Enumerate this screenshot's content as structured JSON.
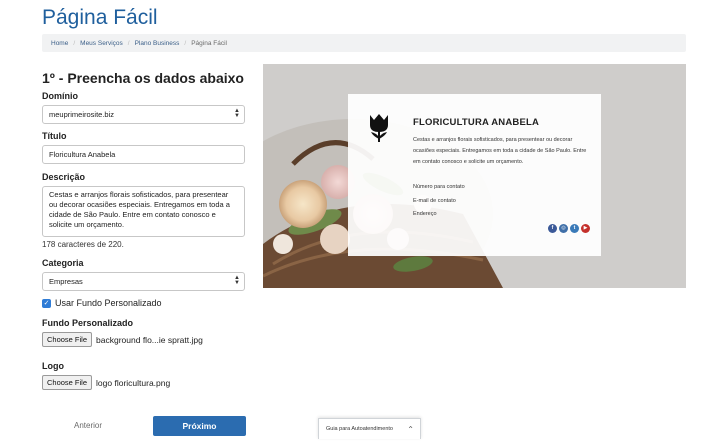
{
  "page": {
    "title": "Página Fácil"
  },
  "breadcrumb": [
    "Home",
    "Meus Serviços",
    "Plano Business",
    "Página Fácil"
  ],
  "form": {
    "step_title": "1º - Preencha os dados abaixo",
    "domain": {
      "label": "Domínio",
      "value": "meuprimeirosite.biz"
    },
    "title": {
      "label": "Título",
      "value": "Floricultura Anabela"
    },
    "description": {
      "label": "Descrição",
      "value": "Cestas e arranjos florais sofisticados, para presentear ou decorar ocasiões especiais. Entregamos em toda a cidade de São Paulo. Entre em contato conosco e solicite um orçamento.",
      "counter": "178 caracteres de 220."
    },
    "category": {
      "label": "Categoria",
      "value": "Empresas"
    },
    "custom_bg_checkbox": {
      "label": "Usar Fundo Personalizado",
      "checked": true
    },
    "custom_bg": {
      "label": "Fundo Personalizado",
      "button": "Choose File",
      "file": "background flo...ie spratt.jpg"
    },
    "logo": {
      "label": "Logo",
      "button": "Choose File",
      "file": "logo floricultura.png"
    }
  },
  "nav": {
    "prev": "Anterior",
    "next": "Próximo"
  },
  "guide": {
    "label": "Guia para Autoatendimento"
  },
  "preview": {
    "brand": "FLORICULTURA ANABELA",
    "description": "Cestas e arranjos florais sofisticados, para presentear ou decorar ocasiões especiais. Entregamos em toda a cidade de São Paulo. Entre em contato conosco e solicite um orçamento.",
    "phone": "Número para contato",
    "email": "E-mail de contato",
    "address": "Endereço",
    "socials": [
      {
        "name": "facebook-icon",
        "glyph": "f",
        "color": "#3b5998"
      },
      {
        "name": "instagram-icon",
        "glyph": "◎",
        "color": "#3f6fa8"
      },
      {
        "name": "twitter-icon",
        "glyph": "t",
        "color": "#3a7ab8"
      },
      {
        "name": "youtube-icon",
        "glyph": "▶",
        "color": "#c4302b"
      }
    ]
  },
  "colors": {
    "accent": "#2b6cb0",
    "title": "#1f5f9d"
  }
}
